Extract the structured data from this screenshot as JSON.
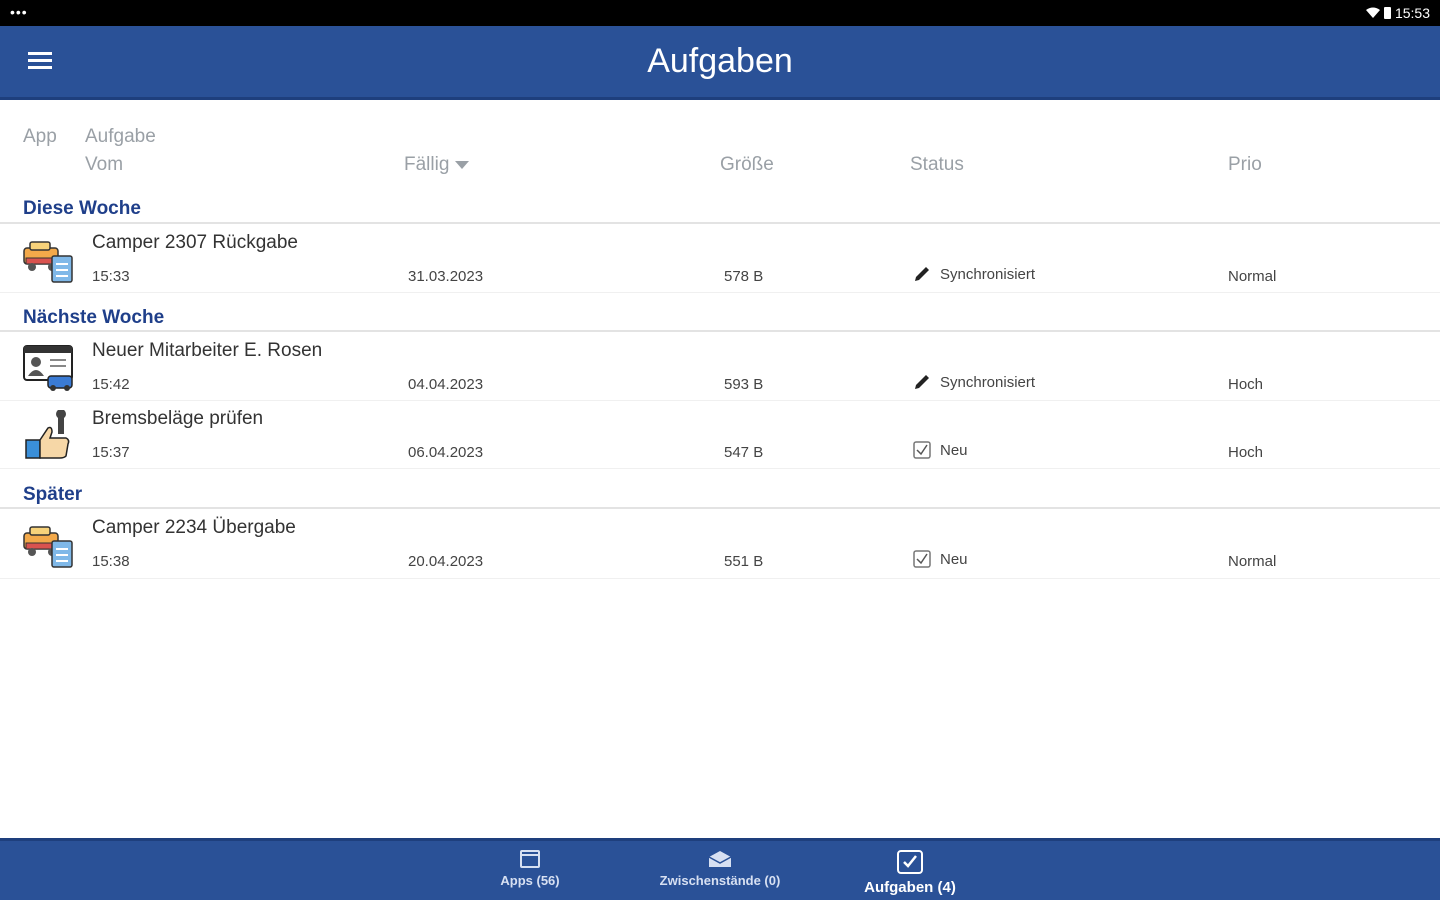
{
  "status_bar": {
    "time": "15:53",
    "left_indicator": "•••"
  },
  "header": {
    "title": "Aufgaben",
    "menu_icon": "menu-icon"
  },
  "columns": {
    "app": "App",
    "task": "Aufgabe",
    "from": "Vom",
    "due": "Fällig",
    "size": "Größe",
    "status": "Status",
    "prio": "Prio"
  },
  "sections": [
    {
      "title": "Diese Woche",
      "rows": [
        {
          "name": "Camper 2307 Rückgabe",
          "time": "15:33",
          "due": "31.03.2023",
          "size": "578 B",
          "status": "Synchronisiert",
          "status_icon": "pencil-icon",
          "prio": "Normal",
          "icon": "camper-clipboard-icon"
        }
      ]
    },
    {
      "title": "Nächste Woche",
      "rows": [
        {
          "name": "Neuer Mitarbeiter E. Rosen",
          "time": "15:42",
          "due": "04.04.2023",
          "size": "593 B",
          "status": "Synchronisiert",
          "status_icon": "pencil-icon",
          "prio": "Hoch",
          "icon": "id-card-car-icon"
        },
        {
          "name": "Bremsbeläge prüfen",
          "time": "15:37",
          "due": "06.04.2023",
          "size": "547 B",
          "status": "Neu",
          "status_icon": "checkbox-icon",
          "prio": "Hoch",
          "icon": "wrench-thumbs-up-icon"
        }
      ]
    },
    {
      "title": "Später",
      "rows": [
        {
          "name": "Camper 2234 Übergabe",
          "time": "15:38",
          "due": "20.04.2023",
          "size": "551 B",
          "status": "Neu",
          "status_icon": "checkbox-icon",
          "prio": "Normal",
          "icon": "camper-clipboard-icon"
        }
      ]
    }
  ],
  "bottom_nav": [
    {
      "label": "Apps (56)",
      "icon": "apps-window-icon",
      "active": false
    },
    {
      "label": "Zwischenstände (0)",
      "icon": "inbox-envelope-icon",
      "active": false
    },
    {
      "label": "Aufgaben (4)",
      "icon": "tasks-checkbox-icon",
      "active": true
    }
  ],
  "colors": {
    "primary": "#2a5197",
    "section_title": "#1f3f8a",
    "header_text": "#9aa0a6"
  }
}
